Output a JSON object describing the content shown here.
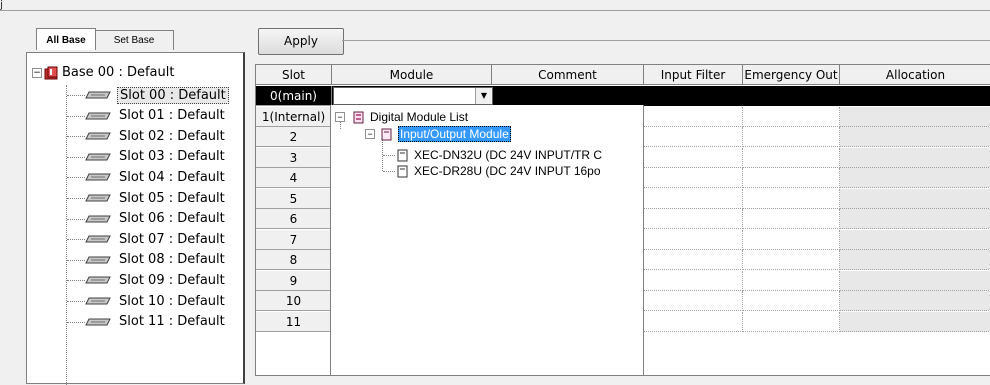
{
  "corner_text": "j",
  "tabs": [
    {
      "label": "All Base",
      "active": true
    },
    {
      "label": "Set Base",
      "active": false
    }
  ],
  "tree": {
    "base_label": "Base 00 : Default",
    "slots": [
      "Slot 00 : Default",
      "Slot 01 : Default",
      "Slot 02 : Default",
      "Slot 03 : Default",
      "Slot 04 : Default",
      "Slot 05 : Default",
      "Slot 06 : Default",
      "Slot 07 : Default",
      "Slot 08 : Default",
      "Slot 09 : Default",
      "Slot 10 : Default",
      "Slot 11 : Default"
    ],
    "selected_index": 0
  },
  "apply_label": "Apply",
  "grid": {
    "columns": [
      "Slot",
      "Module",
      "Comment",
      "Input Filter",
      "Emergency Out",
      "Allocation"
    ],
    "rows": [
      "0(main)",
      "1(Internal)",
      "2",
      "3",
      "4",
      "5",
      "6",
      "7",
      "8",
      "9",
      "10",
      "11"
    ],
    "combo_arrow": "▼"
  },
  "dropdown": {
    "root": "Digital Module List",
    "group": "Input/Output Module",
    "items": [
      "XEC-DN32U (DC 24V INPUT/TR C",
      "XEC-DR28U (DC 24V INPUT 16po"
    ]
  },
  "colors": {
    "highlight": "#3399ff",
    "selected_row": "#000000"
  }
}
